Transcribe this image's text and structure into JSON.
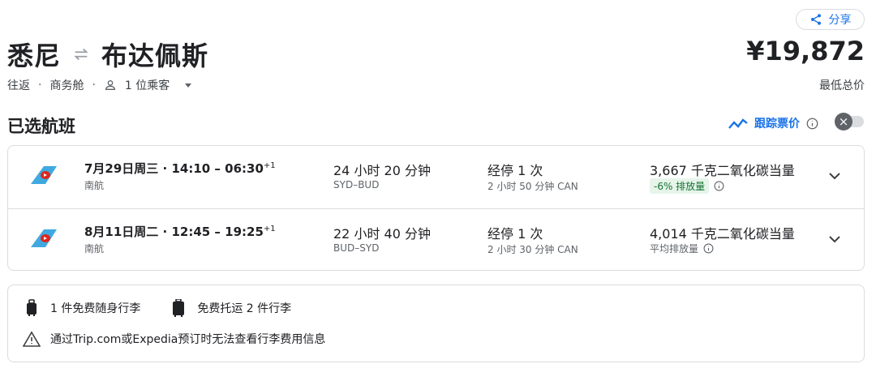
{
  "header": {
    "share_label": "分享",
    "origin": "悉尼",
    "destination": "布达佩斯",
    "price": "¥19,872",
    "price_label": "最低总价",
    "trip_type": "往返",
    "cabin": "商务舱",
    "passengers": "1 位乘客"
  },
  "section": {
    "title": "已选航班",
    "track_label": "跟踪票价"
  },
  "flights": [
    {
      "date_time": "7月29日周三 · 14:10 – 06:30",
      "day_offset": "+1",
      "airline": "南航",
      "duration": "24 小时 20 分钟",
      "route": "SYD–BUD",
      "stops": "经停 1 次",
      "stop_info": "2 小时 50 分钟 CAN",
      "co2": "3,667 千克二氧化碳当量",
      "emission_badge": "-6% 排放量",
      "emission_text": ""
    },
    {
      "date_time": "8月11日周二 · 12:45 – 19:25",
      "day_offset": "+1",
      "airline": "南航",
      "duration": "22 小时 40 分钟",
      "route": "BUD–SYD",
      "stops": "经停 1 次",
      "stop_info": "2 小时 30 分钟 CAN",
      "co2": "4,014 千克二氧化碳当量",
      "emission_badge": "",
      "emission_text": "平均排放量"
    }
  ],
  "baggage": {
    "carry_on": "1 件免费随身行李",
    "checked": "免费托运 2 件行李",
    "warning": "通过Trip.com或Expedia预订时无法查看行李费用信息"
  },
  "colors": {
    "accent": "#1a73e8",
    "badge_bg": "#e6f4ea",
    "badge_text": "#137333",
    "airline_blue": "#3fa9e0",
    "airline_red": "#e1251b"
  },
  "icons": [
    "share-icon",
    "swap-arrows-icon",
    "person-icon",
    "caret-down-icon",
    "trend-icon",
    "info-icon",
    "close-icon",
    "airline-logo-icon",
    "chevron-down-icon",
    "carry-on-bag-icon",
    "checked-bag-icon",
    "warning-icon"
  ]
}
